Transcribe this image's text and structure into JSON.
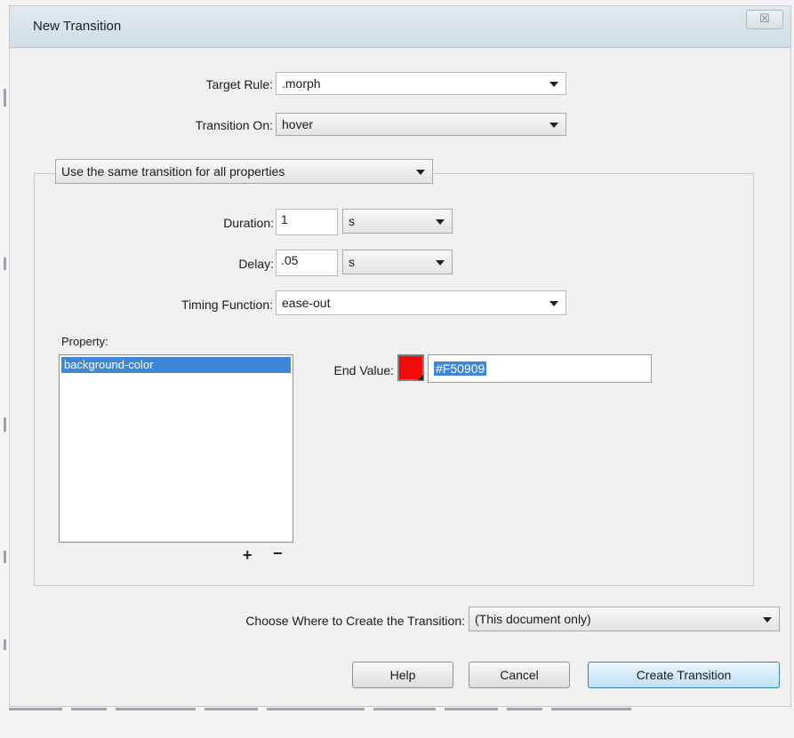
{
  "window": {
    "title": "New Transition",
    "close_glyph": "☒"
  },
  "target_rule": {
    "label": "Target Rule:",
    "value": ".morph"
  },
  "transition_on": {
    "label": "Transition On:",
    "value": "hover"
  },
  "mode_select": {
    "value": "Use the same transition for all properties"
  },
  "duration": {
    "label": "Duration:",
    "value": "1",
    "unit": "s"
  },
  "delay": {
    "label": "Delay:",
    "value": ".05",
    "unit": "s"
  },
  "timing_function": {
    "label": "Timing Function:",
    "value": "ease-out"
  },
  "property": {
    "label": "Property:",
    "items": [
      "background-color"
    ],
    "add": "+",
    "remove": "−"
  },
  "end_value": {
    "label": "End Value:",
    "value": "#F50909",
    "swatch_color": "#F50909"
  },
  "destination": {
    "label": "Choose Where to Create the Transition:",
    "value": "(This document only)"
  },
  "buttons": {
    "help": "Help",
    "cancel": "Cancel",
    "create": "Create Transition"
  },
  "icons": {
    "dropdown": "chevron-down-icon",
    "close": "close-icon"
  }
}
